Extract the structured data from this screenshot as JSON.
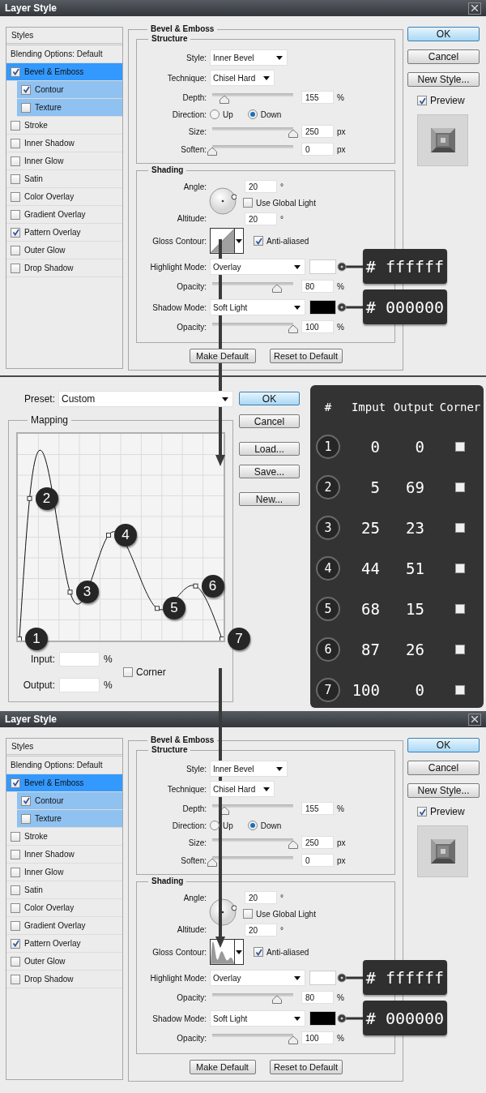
{
  "layer_style_top": {
    "title": "Layer Style",
    "styles_panel": {
      "header": "Styles",
      "blending": "Blending Options: Default",
      "items": [
        {
          "label": "Bevel & Emboss",
          "checked": true,
          "selected": true,
          "children": [
            {
              "label": "Contour",
              "checked": true,
              "selected": false
            },
            {
              "label": "Texture",
              "checked": false,
              "selected": false
            }
          ]
        },
        {
          "label": "Stroke",
          "checked": false,
          "selected": false
        },
        {
          "label": "Inner Shadow",
          "checked": false,
          "selected": false
        },
        {
          "label": "Inner Glow",
          "checked": false,
          "selected": false
        },
        {
          "label": "Satin",
          "checked": false,
          "selected": false
        },
        {
          "label": "Color Overlay",
          "checked": false,
          "selected": false
        },
        {
          "label": "Gradient Overlay",
          "checked": false,
          "selected": false
        },
        {
          "label": "Pattern Overlay",
          "checked": true,
          "selected": false
        },
        {
          "label": "Outer Glow",
          "checked": false,
          "selected": false
        },
        {
          "label": "Drop Shadow",
          "checked": false,
          "selected": false
        }
      ]
    },
    "bevel_emboss": {
      "title": "Bevel & Emboss",
      "structure": {
        "title": "Structure",
        "style": {
          "label": "Style:",
          "value": "Inner Bevel"
        },
        "technique": {
          "label": "Technique:",
          "value": "Chisel Hard"
        },
        "depth": {
          "label": "Depth:",
          "level": 0.15,
          "value": "155",
          "unit": "%"
        },
        "direction": {
          "label": "Direction:",
          "options": [
            {
              "label": "Up",
              "selected": false
            },
            {
              "label": "Down",
              "selected": true
            }
          ]
        },
        "size": {
          "label": "Size:",
          "level": 1,
          "value": "250",
          "unit": "px"
        },
        "soften": {
          "label": "Soften:",
          "level": 0,
          "value": "0",
          "unit": "px"
        }
      },
      "shading": {
        "title": "Shading",
        "angle": {
          "label": "Angle:",
          "value": "20",
          "unit": "°"
        },
        "global_light": {
          "label": "Use Global Light",
          "checked": false
        },
        "altitude": {
          "label": "Altitude:",
          "value": "20",
          "unit": "°"
        },
        "gloss_contour": {
          "label": "Gloss Contour:",
          "kind": "linear"
        },
        "anti_aliased": {
          "label": "Anti-aliased",
          "checked": true
        },
        "highlight_mode": {
          "label": "Highlight Mode:",
          "value": "Overlay",
          "color": "#ffffff",
          "callout": "# ffffff"
        },
        "highlight_opacity": {
          "label": "Opacity:",
          "level": 0.8,
          "value": "80",
          "unit": "%"
        },
        "shadow_mode": {
          "label": "Shadow Mode:",
          "value": "Soft Light",
          "color": "#000000",
          "callout": "# 000000"
        },
        "shadow_opacity": {
          "label": "Opacity:",
          "level": 1,
          "value": "100",
          "unit": "%"
        }
      },
      "buttons": [
        "Make Default",
        "Reset to Default"
      ]
    },
    "buttons": [
      {
        "label": "OK",
        "primary": true
      },
      {
        "label": "Cancel",
        "primary": false
      },
      {
        "label": "New Style...",
        "primary": false
      }
    ],
    "preview": {
      "label": "Preview",
      "checked": true
    }
  },
  "contour_editor": {
    "preset": {
      "label": "Preset:",
      "value": "Custom"
    },
    "mapping": {
      "title": "Mapping",
      "point_badges": [
        "1",
        "2",
        "3",
        "4",
        "5",
        "6",
        "7"
      ],
      "input": {
        "label": "Input:",
        "unit": "%"
      },
      "output": {
        "label": "Output:",
        "unit": "%"
      },
      "corner": {
        "label": "Corner",
        "checked": false
      }
    },
    "buttons": [
      {
        "label": "OK",
        "primary": true
      },
      {
        "label": "Cancel",
        "primary": false
      },
      {
        "label": "Load...",
        "primary": false
      },
      {
        "label": "Save...",
        "primary": false
      },
      {
        "label": "New...",
        "primary": false
      }
    ],
    "points_table": {
      "columns": [
        "#",
        "Imput",
        "Output",
        "Corner"
      ],
      "rows": [
        {
          "number": "1",
          "input": "0",
          "output": "0",
          "corner": false
        },
        {
          "number": "2",
          "input": "5",
          "output": "69",
          "corner": false
        },
        {
          "number": "3",
          "input": "25",
          "output": "23",
          "corner": false
        },
        {
          "number": "4",
          "input": "44",
          "output": "51",
          "corner": false
        },
        {
          "number": "5",
          "input": "68",
          "output": "15",
          "corner": false
        },
        {
          "number": "6",
          "input": "87",
          "output": "26",
          "corner": false
        },
        {
          "number": "7",
          "input": "100",
          "output": "0",
          "corner": false
        }
      ]
    }
  },
  "layer_style_bottom": {
    "title": "Layer Style",
    "styles_panel": {
      "header": "Styles",
      "blending": "Blending Options: Default",
      "items": [
        {
          "label": "Bevel & Emboss",
          "checked": true,
          "selected": true,
          "children": [
            {
              "label": "Contour",
              "checked": true,
              "selected": false
            },
            {
              "label": "Texture",
              "checked": false,
              "selected": false
            }
          ]
        },
        {
          "label": "Stroke",
          "checked": false,
          "selected": false
        },
        {
          "label": "Inner Shadow",
          "checked": false,
          "selected": false
        },
        {
          "label": "Inner Glow",
          "checked": false,
          "selected": false
        },
        {
          "label": "Satin",
          "checked": false,
          "selected": false
        },
        {
          "label": "Color Overlay",
          "checked": false,
          "selected": false
        },
        {
          "label": "Gradient Overlay",
          "checked": false,
          "selected": false
        },
        {
          "label": "Pattern Overlay",
          "checked": true,
          "selected": false
        },
        {
          "label": "Outer Glow",
          "checked": false,
          "selected": false
        },
        {
          "label": "Drop Shadow",
          "checked": false,
          "selected": false
        }
      ]
    },
    "bevel_emboss": {
      "title": "Bevel & Emboss",
      "structure": {
        "title": "Structure",
        "style": {
          "label": "Style:",
          "value": "Inner Bevel"
        },
        "technique": {
          "label": "Technique:",
          "value": "Chisel Hard"
        },
        "depth": {
          "label": "Depth:",
          "level": 0.15,
          "value": "155",
          "unit": "%"
        },
        "direction": {
          "label": "Direction:",
          "options": [
            {
              "label": "Up",
              "selected": false
            },
            {
              "label": "Down",
              "selected": true
            }
          ]
        },
        "size": {
          "label": "Size:",
          "level": 1,
          "value": "250",
          "unit": "px"
        },
        "soften": {
          "label": "Soften:",
          "level": 0,
          "value": "0",
          "unit": "px"
        }
      },
      "shading": {
        "title": "Shading",
        "angle": {
          "label": "Angle:",
          "value": "20",
          "unit": "°"
        },
        "global_light": {
          "label": "Use Global Light",
          "checked": false
        },
        "altitude": {
          "label": "Altitude:",
          "value": "20",
          "unit": "°"
        },
        "gloss_contour": {
          "label": "Gloss Contour:",
          "kind": "custom"
        },
        "anti_aliased": {
          "label": "Anti-aliased",
          "checked": true
        },
        "highlight_mode": {
          "label": "Highlight Mode:",
          "value": "Overlay",
          "color": "#ffffff",
          "callout": "# ffffff"
        },
        "highlight_opacity": {
          "label": "Opacity:",
          "level": 0.8,
          "value": "80",
          "unit": "%"
        },
        "shadow_mode": {
          "label": "Shadow Mode:",
          "value": "Soft Light",
          "color": "#000000",
          "callout": "# 000000"
        },
        "shadow_opacity": {
          "label": "Opacity:",
          "level": 1,
          "value": "100",
          "unit": "%"
        }
      },
      "buttons": [
        "Make Default",
        "Reset to Default"
      ]
    },
    "buttons": [
      {
        "label": "OK",
        "primary": true
      },
      {
        "label": "Cancel",
        "primary": false
      },
      {
        "label": "New Style...",
        "primary": false
      }
    ],
    "preview": {
      "label": "Preview",
      "checked": true
    }
  }
}
